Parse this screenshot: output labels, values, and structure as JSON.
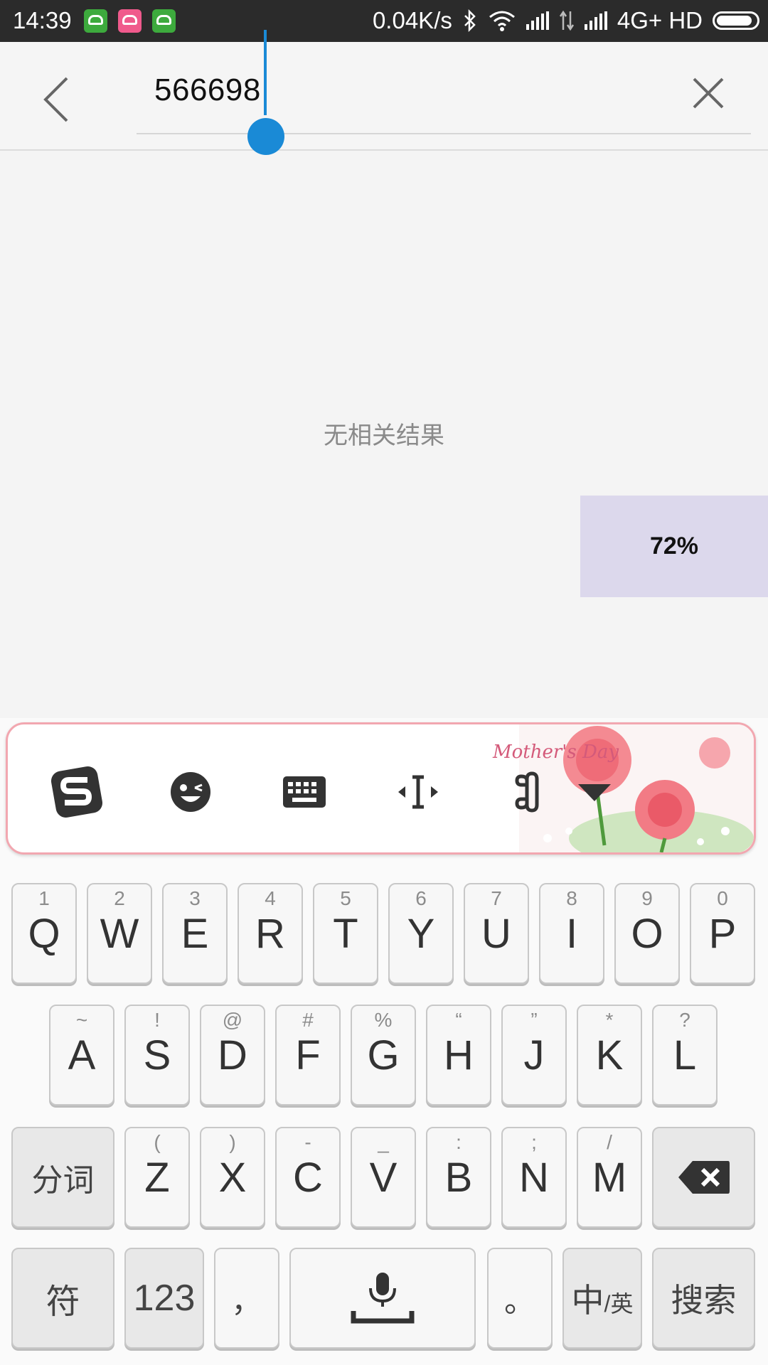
{
  "status_bar": {
    "time": "14:39",
    "network_speed": "0.04K/s",
    "network_type": "4G+ HD"
  },
  "search": {
    "value": "566698"
  },
  "results": {
    "empty_message": "无相关结果"
  },
  "overlay": {
    "progress_text": "72%"
  },
  "keyboard": {
    "banner_text": "Mother's Day",
    "row1": [
      {
        "sub": "1",
        "main": "Q"
      },
      {
        "sub": "2",
        "main": "W"
      },
      {
        "sub": "3",
        "main": "E"
      },
      {
        "sub": "4",
        "main": "R"
      },
      {
        "sub": "5",
        "main": "T"
      },
      {
        "sub": "6",
        "main": "Y"
      },
      {
        "sub": "7",
        "main": "U"
      },
      {
        "sub": "8",
        "main": "I"
      },
      {
        "sub": "9",
        "main": "O"
      },
      {
        "sub": "0",
        "main": "P"
      }
    ],
    "row2": [
      {
        "sub": "~",
        "main": "A"
      },
      {
        "sub": "!",
        "main": "S"
      },
      {
        "sub": "@",
        "main": "D"
      },
      {
        "sub": "#",
        "main": "F"
      },
      {
        "sub": "%",
        "main": "G"
      },
      {
        "sub": "“",
        "main": "H"
      },
      {
        "sub": "”",
        "main": "J"
      },
      {
        "sub": "*",
        "main": "K"
      },
      {
        "sub": "?",
        "main": "L"
      }
    ],
    "row3": [
      {
        "sub": "(",
        "main": "Z"
      },
      {
        "sub": ")",
        "main": "X"
      },
      {
        "sub": "-",
        "main": "C"
      },
      {
        "sub": "_",
        "main": "V"
      },
      {
        "sub": ":",
        "main": "B"
      },
      {
        "sub": ";",
        "main": "N"
      },
      {
        "sub": "/",
        "main": "M"
      }
    ],
    "segment_label": "分词",
    "symbol_label": "符",
    "number_label": "123",
    "comma_label": "，",
    "period_label": "。",
    "lang_label_main": "中",
    "lang_label_sub": "/英",
    "search_label": "搜索"
  }
}
